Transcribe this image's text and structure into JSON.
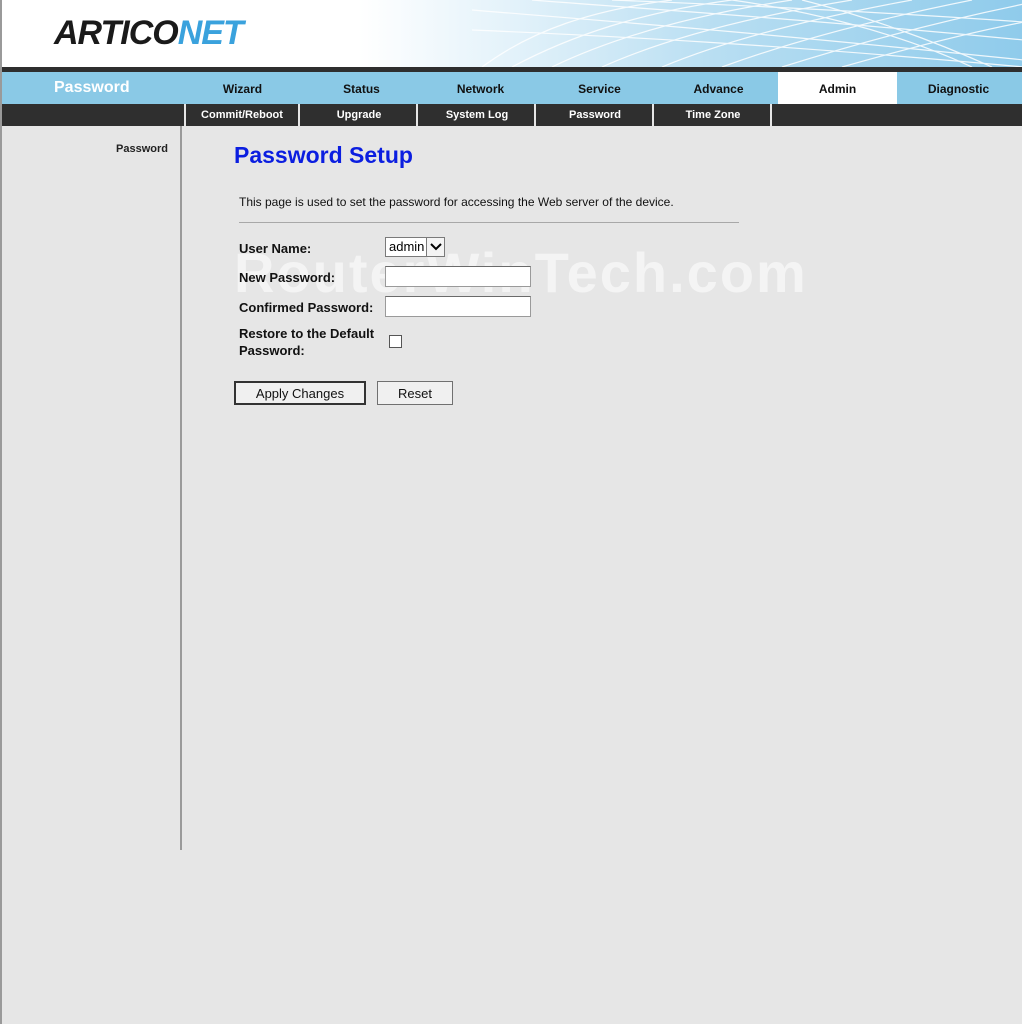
{
  "brand": {
    "logo_part1": "ARTICO",
    "logo_part2": "NET"
  },
  "main_nav": {
    "section_title": "Password",
    "items": [
      {
        "label": "Wizard"
      },
      {
        "label": "Status"
      },
      {
        "label": "Network"
      },
      {
        "label": "Service"
      },
      {
        "label": "Advance"
      },
      {
        "label": "Admin"
      },
      {
        "label": "Diagnostic"
      }
    ],
    "active": "Admin"
  },
  "sub_nav": {
    "items": [
      {
        "label": "Commit/Reboot"
      },
      {
        "label": "Upgrade"
      },
      {
        "label": "System Log"
      },
      {
        "label": "Password"
      },
      {
        "label": "Time Zone"
      }
    ]
  },
  "sidebar": {
    "items": [
      {
        "label": "Password"
      }
    ]
  },
  "content": {
    "title": "Password Setup",
    "description": "This page is used to set the password for accessing the Web server of the device.",
    "watermark": "RouterWinTech.com",
    "form": {
      "user_name_label": "User Name:",
      "user_name_value": "admin",
      "new_password_label": "New Password:",
      "new_password_value": "",
      "confirmed_password_label": "Confirmed Password:",
      "confirmed_password_value": "",
      "restore_label_line1": "Restore to the Default",
      "restore_label_line2": "Password:",
      "restore_checked": false
    },
    "buttons": {
      "apply": "Apply Changes",
      "reset": "Reset"
    }
  },
  "colors": {
    "nav_bg": "#8ac9e6",
    "sub_nav_bg": "#2f2f2f",
    "title_blue": "#0b1ee0",
    "logo_blue": "#3aa2dd",
    "page_bg": "#e6e6e6"
  }
}
